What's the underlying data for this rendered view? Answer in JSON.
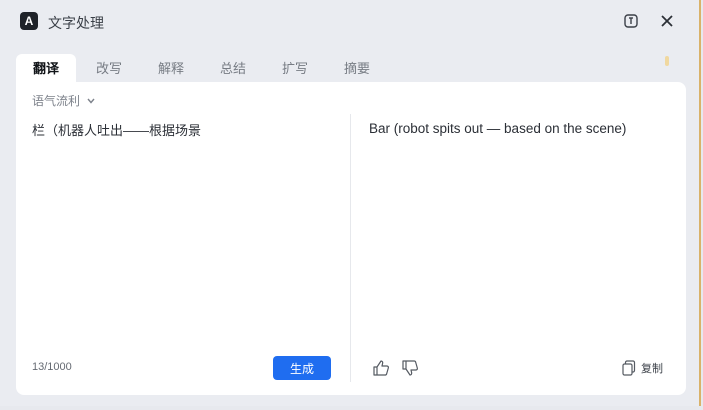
{
  "window": {
    "logo_letter": "A",
    "title": "文字处理"
  },
  "tabs": [
    {
      "label": "翻译",
      "active": true
    },
    {
      "label": "改写",
      "active": false
    },
    {
      "label": "解释",
      "active": false
    },
    {
      "label": "总结",
      "active": false
    },
    {
      "label": "扩写",
      "active": false
    },
    {
      "label": "摘要",
      "active": false
    }
  ],
  "tone": {
    "label": "语气流利",
    "icon": "chevron-down-icon"
  },
  "source": {
    "text": "栏（机器人吐出——根据场景",
    "char_count": "13/1000",
    "generate_label": "生成"
  },
  "result": {
    "text": "Bar (robot spits out — based on the scene)",
    "copy_label": "复制"
  },
  "colors": {
    "accent": "#1f6df0",
    "background": "#eaecf1",
    "panel": "#ffffff"
  }
}
